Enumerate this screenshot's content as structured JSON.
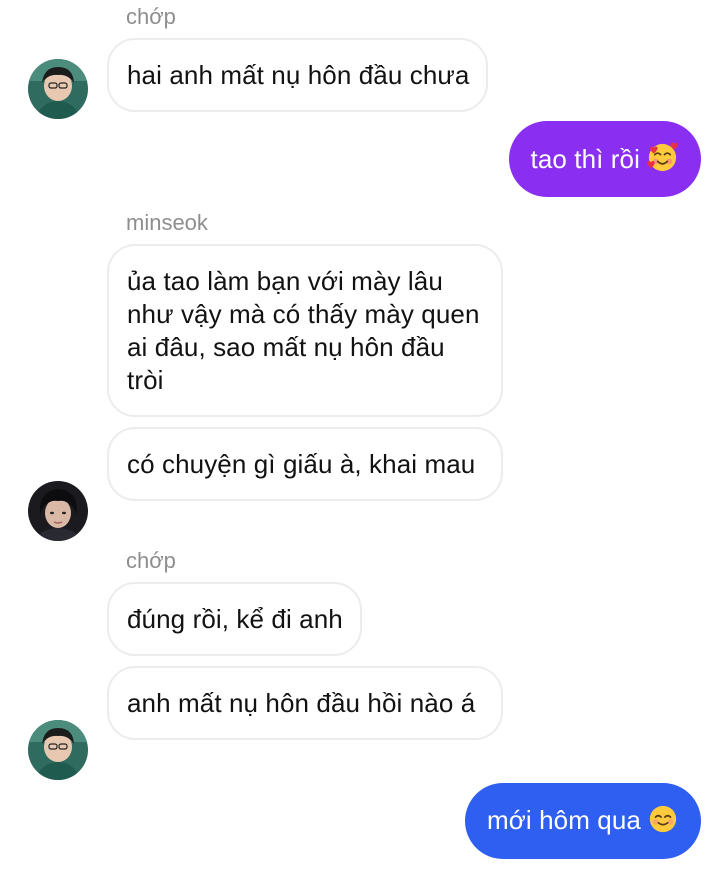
{
  "messages": [
    {
      "sender": "chớp",
      "text": "hai anh mất nụ hôn đầu chưa"
    },
    {
      "text": "tao thì rồi",
      "emoji": "smiling-face-with-hearts"
    },
    {
      "sender": "minseok",
      "text": "ủa tao làm bạn với mày lâu như vậy mà có thấy mày quen ai đâu, sao mất nụ hôn đầu tròi"
    },
    {
      "text": "có chuyện gì giấu à, khai mau"
    },
    {
      "sender": "chớp",
      "text": "đúng rồi, kể đi anh"
    },
    {
      "text": "anh mất nụ hôn đầu hồi nào á"
    },
    {
      "text": "mới hôm qua",
      "emoji": "smiling-face"
    }
  ],
  "colors": {
    "outgoing_top": "#8a2ff2",
    "outgoing_bottom": "#2f5ff0",
    "incoming_border": "#ececec",
    "sender_name": "#8e8e8e"
  }
}
